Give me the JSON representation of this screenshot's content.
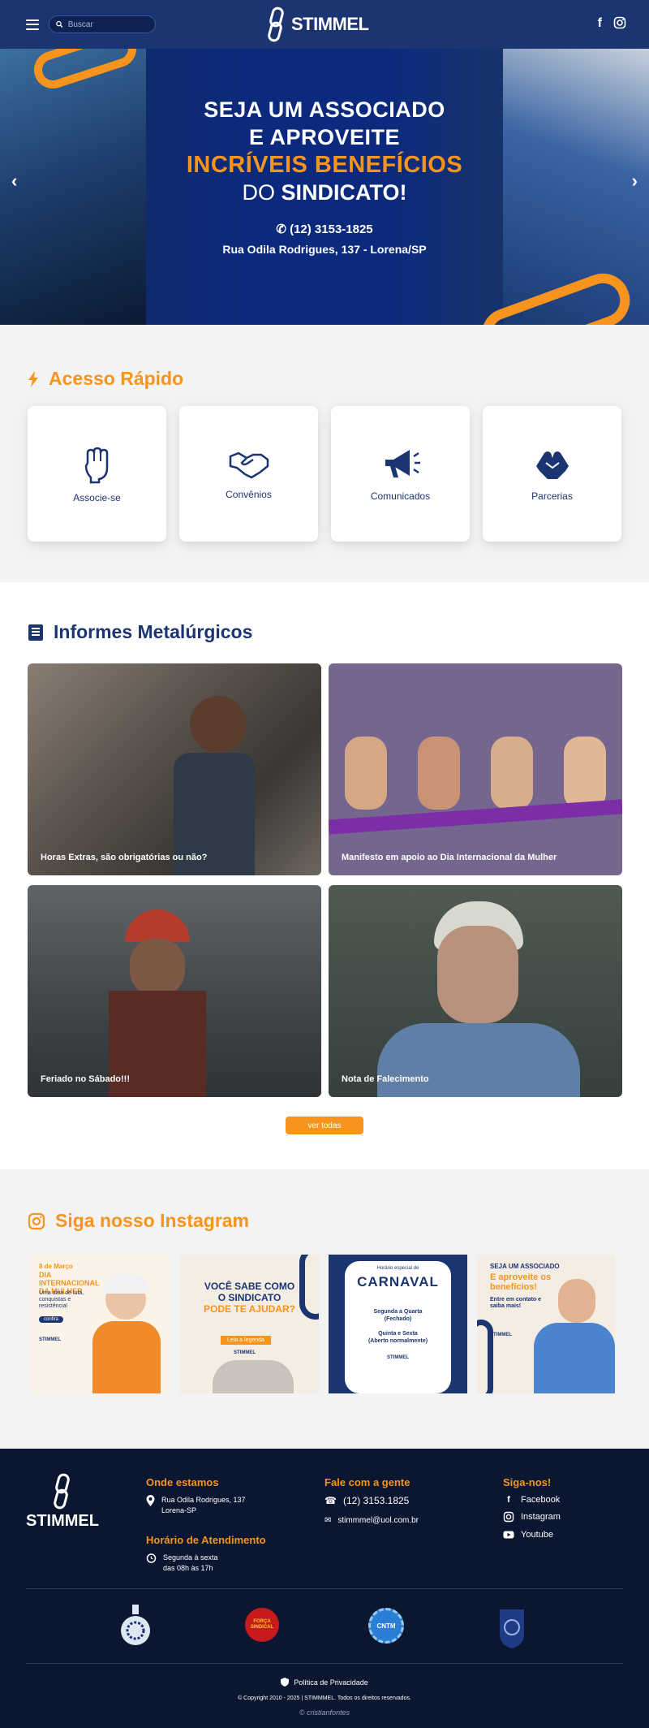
{
  "header": {
    "search_placeholder": "Buscar",
    "logo_text": "STIMMEL"
  },
  "hero": {
    "line1": "SEJA UM ASSOCIADO",
    "line2": "E APROVEITE",
    "line3": "INCRÍVEIS BENEFÍCIOS",
    "line4a": "DO ",
    "line4b": "SINDICATO!",
    "phone": "(12) 3153-1825",
    "address": "Rua Odila Rodrigues, 137 - Lorena/SP"
  },
  "quick_access": {
    "title": "Acesso Rápido",
    "items": [
      {
        "label": "Associe-se",
        "icon": "raised-fist-icon"
      },
      {
        "label": "Convênios",
        "icon": "handshake-icon"
      },
      {
        "label": "Comunicados",
        "icon": "megaphone-icon"
      },
      {
        "label": "Parcerias",
        "icon": "hands-clasp-icon"
      }
    ]
  },
  "news": {
    "title": "Informes Metalúrgicos",
    "items": [
      {
        "caption": "Horas Extras, são obrigatórias ou não?"
      },
      {
        "caption": "Manifesto em apoio ao Dia Internacional da Mulher"
      },
      {
        "caption": "Feriado no Sábado!!!"
      },
      {
        "caption": "Nota de Falecimento"
      }
    ],
    "button": "ver todas"
  },
  "instagram": {
    "title": "Siga nosso Instagram",
    "posts": [
      {
        "l1": "8 de Março",
        "l2": "DIA INTERNACIONAL",
        "l3": "DA MULHER",
        "l4": "Uma data de luta, conquistas e resistência!",
        "l5": "confira",
        "brand": "STIMMEL"
      },
      {
        "l1": "VOCÊ SABE COMO",
        "l2": "O SINDICATO",
        "l3": "PODE TE AJUDAR?",
        "l4": "Leia a legenda",
        "brand": "STIMMEL"
      },
      {
        "l1": "Horário especial de",
        "l2": "CARNAVAL",
        "l3": "Segunda a Quarta",
        "l4": "(Fechado)",
        "l5": "Quinta e Sexta",
        "l6": "(Aberto normalmente)",
        "brand": "STIMMEL"
      },
      {
        "l1": "SEJA UM ASSOCIADO",
        "l2": "E aproveite os",
        "l3": "benefícios!",
        "l4": "Entre em contato e saiba mais!",
        "brand": "STIMMEL"
      }
    ]
  },
  "footer": {
    "logo_text": "STIMMEL",
    "where_title": "Onde estamos",
    "address1": "Rua Odila Rodrigues, 137",
    "address2": "Lorena-SP",
    "hours_title": "Horário de Atendimento",
    "hours1": "Segunda à sexta",
    "hours2": "das 08h às 17h",
    "contact_title": "Fale com a gente",
    "phone": "(12) 3153.1825",
    "email": "stimmmel@uol.com.br",
    "follow_title": "Siga-nos!",
    "facebook": "Facebook",
    "instagram": "Instagram",
    "youtube": "Youtube",
    "partner2_text": "FORÇA SINDICAL",
    "partner3_text": "CNTM",
    "privacy": "Política de Privacidade",
    "copyright": "© Copyright 2010 - 2025 | STIMMMEL. Todos os direitos reservados.",
    "credit": "© cristianfontes"
  },
  "colors": {
    "navy": "#1b3472",
    "orange": "#f7941d",
    "footer_bg": "#0b1730"
  }
}
